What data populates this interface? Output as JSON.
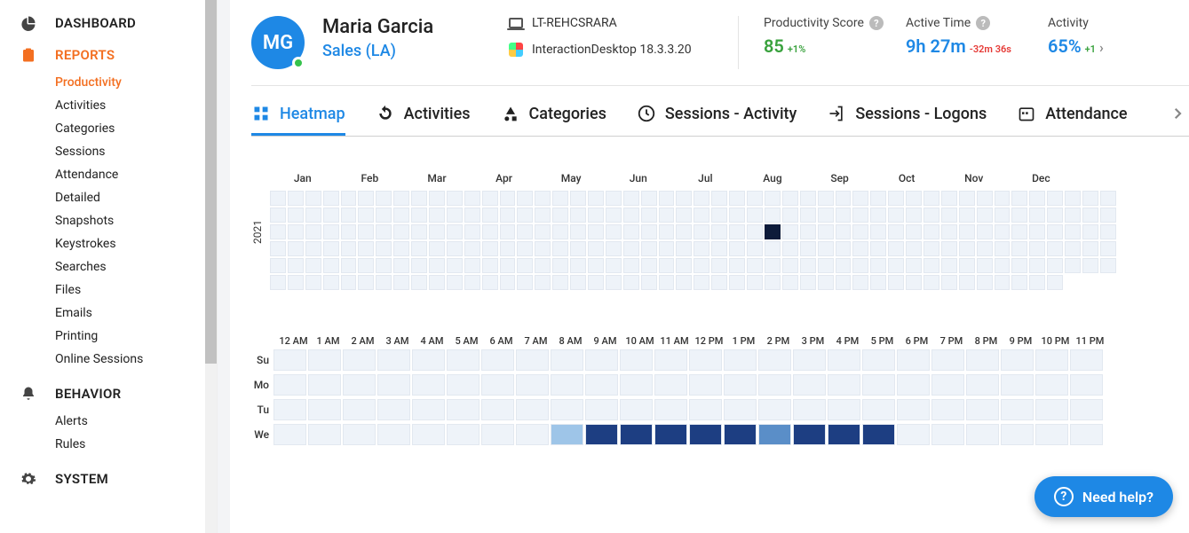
{
  "sidebar": {
    "sections": [
      {
        "label": "DASHBOARD",
        "icon": "pie"
      },
      {
        "label": "REPORTS",
        "icon": "clipboard",
        "active": true,
        "items": [
          "Productivity",
          "Activities",
          "Categories",
          "Sessions",
          "Attendance",
          "Detailed",
          "Snapshots",
          "Keystrokes",
          "Searches",
          "Files",
          "Emails",
          "Printing",
          "Online Sessions"
        ],
        "activeItem": "Productivity"
      },
      {
        "label": "BEHAVIOR",
        "icon": "bell",
        "items": [
          "Alerts",
          "Rules"
        ]
      },
      {
        "label": "SYSTEM",
        "icon": "gear"
      }
    ]
  },
  "header": {
    "initials": "MG",
    "name": "Maria Garcia",
    "dept": "Sales (LA)",
    "device": "LT-REHCSRARA",
    "app": "InteractionDesktop 18.3.3.20",
    "metrics": [
      {
        "label": "Productivity Score",
        "value": "85",
        "delta": "+1%",
        "deltaClass": "green",
        "valueClass": "green"
      },
      {
        "label": "Active Time",
        "value": "9h 27m",
        "delta": "-32m 36s",
        "deltaClass": "red",
        "valueClass": "blue"
      },
      {
        "label": "Activity",
        "value": "65%",
        "delta": "+1",
        "deltaClass": "green",
        "valueClass": "blue",
        "truncated": true
      }
    ]
  },
  "tabs": [
    "Heatmap",
    "Activities",
    "Categories",
    "Sessions - Activity",
    "Sessions - Logons",
    "Attendance"
  ],
  "activeTab": "Heatmap",
  "chart_data": [
    {
      "type": "heatmap",
      "title": "Yearly activity heatmap",
      "ylabel": "2021",
      "months": [
        "Jan",
        "Feb",
        "Mar",
        "Apr",
        "May",
        "Jun",
        "Jul",
        "Aug",
        "Sep",
        "Oct",
        "Nov",
        "Dec"
      ],
      "weeks": 48,
      "rows": 6,
      "cells_filled_per_row": [
        48,
        48,
        48,
        48,
        48,
        45
      ],
      "highlight": {
        "row": 2,
        "col": 28
      },
      "note": "All cells ~0 except highlighted (row index 2, week index 28 ≈ late July) which is a single dark maximum cell."
    },
    {
      "type": "heatmap",
      "title": "Hourly activity heatmap",
      "hours": [
        "12 AM",
        "1 AM",
        "2 AM",
        "3 AM",
        "4 AM",
        "5 AM",
        "6 AM",
        "7 AM",
        "8 AM",
        "9 AM",
        "10 AM",
        "11 AM",
        "12 PM",
        "1 PM",
        "2 PM",
        "3 PM",
        "4 PM",
        "5 PM",
        "6 PM",
        "7 PM",
        "8 PM",
        "9 PM",
        "10 PM",
        "11 PM"
      ],
      "days": [
        "Su",
        "Mo",
        "Tu",
        "We"
      ],
      "intensity": {
        "Su": [
          0,
          0,
          0,
          0,
          0,
          0,
          0,
          0,
          0,
          0,
          0,
          0,
          0,
          0,
          0,
          0,
          0,
          0,
          0,
          0,
          0,
          0,
          0,
          0
        ],
        "Mo": [
          0,
          0,
          0,
          0,
          0,
          0,
          0,
          0,
          0,
          0,
          0,
          0,
          0,
          0,
          0,
          0,
          0,
          0,
          0,
          0,
          0,
          0,
          0,
          0
        ],
        "Tu": [
          0,
          0,
          0,
          0,
          0,
          0,
          0,
          0,
          0,
          0,
          0,
          0,
          0,
          0,
          0,
          0,
          0,
          0,
          0,
          0,
          0,
          0,
          0,
          0
        ],
        "We": [
          0,
          0,
          0,
          0,
          0,
          0,
          0,
          0,
          1,
          3,
          3,
          3,
          3,
          3,
          2,
          3,
          3,
          3,
          0,
          0,
          0,
          0,
          0,
          0
        ]
      },
      "scale": "0=none, 1=light, 2=medium, 3=dark"
    }
  ],
  "help": "Need help?"
}
